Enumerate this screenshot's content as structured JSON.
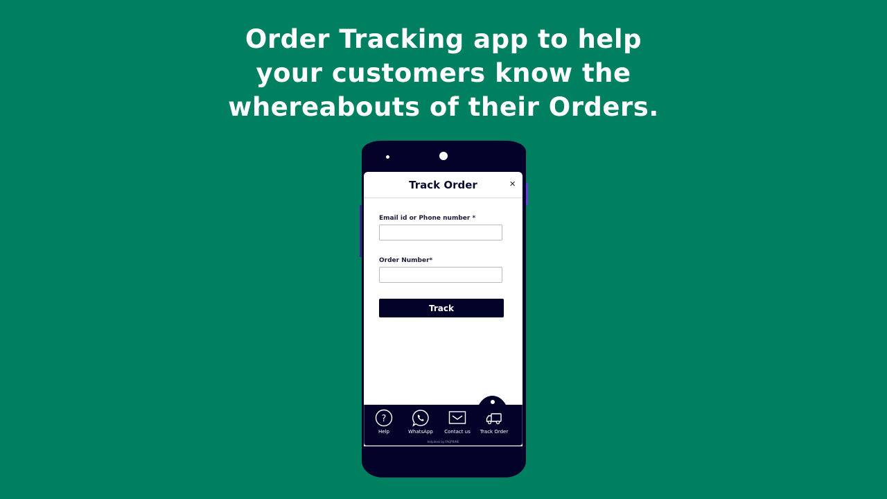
{
  "headline": {
    "line1": "Order Tracking app to help",
    "line2": "your customers know the",
    "line3": "whereabouts of their Orders."
  },
  "colors": {
    "background": "#008060",
    "phone": "#03032a",
    "accent_button": "#03032a",
    "side_button": "#6b3fd6"
  },
  "modal": {
    "title": "Track Order",
    "close_icon": "×",
    "fields": [
      {
        "label": "Email id or Phone number *",
        "value": "",
        "placeholder": ""
      },
      {
        "label": "Order Number*",
        "value": "",
        "placeholder": ""
      }
    ],
    "submit_label": "Track"
  },
  "bottom_nav": {
    "items": [
      {
        "label": "Help",
        "icon": "question-circle-icon"
      },
      {
        "label": "WhatsApp",
        "icon": "whatsapp-icon"
      },
      {
        "label": "Contact us",
        "icon": "envelope-icon"
      },
      {
        "label": "Track Order",
        "icon": "truck-icon",
        "active": true
      }
    ],
    "credit": "Helpdesk by FAQPRIME"
  }
}
